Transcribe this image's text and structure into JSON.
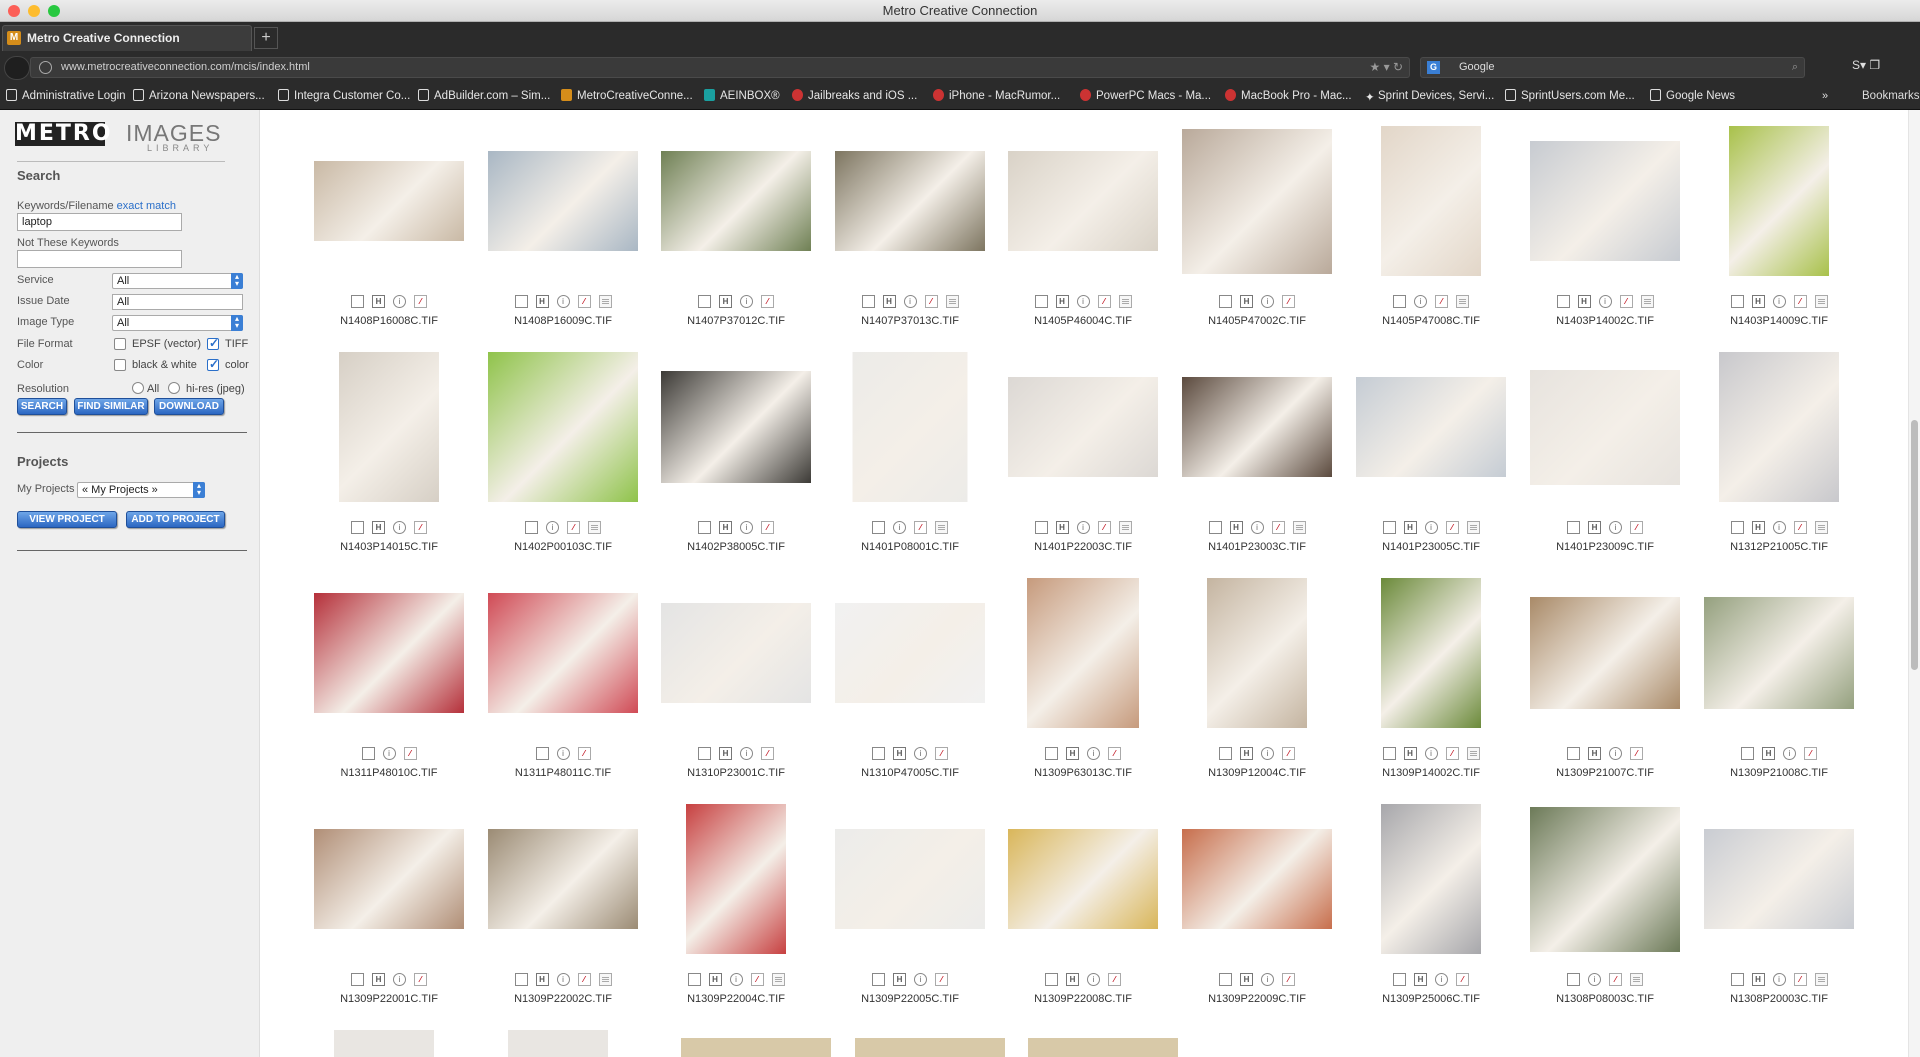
{
  "window": {
    "title": "Metro Creative Connection"
  },
  "tab": {
    "title": "Metro Creative Connection",
    "new_tab": "+"
  },
  "nav": {
    "url": "www.metrocreativeconnection.com/mcis/index.html",
    "search_engine": "Google"
  },
  "bookmarks": {
    "items": [
      "Administrative Login",
      "Arizona Newspapers...",
      "Integra Customer Co...",
      "AdBuilder.com – Sim...",
      "MetroCreativeConne...",
      "AEINBOX®",
      "Jailbreaks and iOS ...",
      "iPhone - MacRumor...",
      "PowerPC Macs - Ma...",
      "MacBook Pro - Mac...",
      "Sprint Devices, Servi...",
      "SprintUsers.com Me...",
      "Google News"
    ],
    "more": "»",
    "right": "Bookmarks"
  },
  "sidebar": {
    "logo_metro": "METRO",
    "logo_images": "IMAGES",
    "logo_library": "LIBRARY",
    "search_heading": "Search",
    "keywords_label": "Keywords/Filename",
    "exact_match": "exact match",
    "keywords_value": "laptop",
    "not_keywords_label": "Not These Keywords",
    "not_keywords_value": "",
    "service_label": "Service",
    "service_value": "All",
    "issue_date_label": "Issue Date",
    "issue_date_value": "All",
    "image_type_label": "Image Type",
    "image_type_value": "All",
    "file_format_label": "File Format",
    "epsf_label": "EPSF (vector)",
    "tiff_label": "TIFF",
    "color_label": "Color",
    "bw_label": "black & white",
    "color_opt_label": "color",
    "resolution_label": "Resolution",
    "res_all": "All",
    "res_hires": "hi-res (jpeg)",
    "btn_search": "SEARCH",
    "btn_find_similar": "FIND SIMILAR",
    "btn_download": "DOWNLOAD",
    "projects_heading": "Projects",
    "my_projects_label": "My Projects",
    "my_projects_value": "« My Projects »",
    "btn_view_project": "VIEW PROJECT",
    "btn_add_to_project": "ADD TO PROJECT"
  },
  "results": [
    {
      "file": "N1408P16008C.TIF",
      "w": 150,
      "h": 80,
      "icons": "shid"
    },
    {
      "file": "N1408P16009C.TIF",
      "w": 150,
      "h": 100,
      "icons": "shidx"
    },
    {
      "file": "N1407P37012C.TIF",
      "w": 150,
      "h": 100,
      "icons": "shid"
    },
    {
      "file": "N1407P37013C.TIF",
      "w": 150,
      "h": 100,
      "icons": "shidx"
    },
    {
      "file": "N1405P46004C.TIF",
      "w": 150,
      "h": 100,
      "icons": "shidx"
    },
    {
      "file": "N1405P47002C.TIF",
      "w": 150,
      "h": 145,
      "icons": "shid"
    },
    {
      "file": "N1405P47008C.TIF",
      "w": 100,
      "h": 150,
      "icons": "sidx"
    },
    {
      "file": "N1403P14002C.TIF",
      "w": 150,
      "h": 120,
      "icons": "shidx"
    },
    {
      "file": "N1403P14009C.TIF",
      "w": 100,
      "h": 150,
      "icons": "shidx"
    },
    {
      "file": "N1403P14015C.TIF",
      "w": 100,
      "h": 150,
      "icons": "shid"
    },
    {
      "file": "N1402P00103C.TIF",
      "w": 150,
      "h": 150,
      "icons": "sidx"
    },
    {
      "file": "N1402P38005C.TIF",
      "w": 150,
      "h": 112,
      "icons": "shid"
    },
    {
      "file": "N1401P08001C.TIF",
      "w": 115,
      "h": 150,
      "icons": "sidx"
    },
    {
      "file": "N1401P22003C.TIF",
      "w": 150,
      "h": 100,
      "icons": "shidx"
    },
    {
      "file": "N1401P23003C.TIF",
      "w": 150,
      "h": 100,
      "icons": "shidx"
    },
    {
      "file": "N1401P23005C.TIF",
      "w": 150,
      "h": 100,
      "icons": "shidx"
    },
    {
      "file": "N1401P23009C.TIF",
      "w": 150,
      "h": 115,
      "icons": "shid"
    },
    {
      "file": "N1312P21005C.TIF",
      "w": 120,
      "h": 150,
      "icons": "shidx"
    },
    {
      "file": "N1311P48010C.TIF",
      "w": 150,
      "h": 120,
      "icons": "sid"
    },
    {
      "file": "N1311P48011C.TIF",
      "w": 150,
      "h": 120,
      "icons": "sid"
    },
    {
      "file": "N1310P23001C.TIF",
      "w": 150,
      "h": 100,
      "icons": "shid"
    },
    {
      "file": "N1310P47005C.TIF",
      "w": 150,
      "h": 100,
      "icons": "shid"
    },
    {
      "file": "N1309P63013C.TIF",
      "w": 112,
      "h": 150,
      "icons": "shid"
    },
    {
      "file": "N1309P12004C.TIF",
      "w": 100,
      "h": 150,
      "icons": "shid"
    },
    {
      "file": "N1309P14002C.TIF",
      "w": 100,
      "h": 150,
      "icons": "shidx"
    },
    {
      "file": "N1309P21007C.TIF",
      "w": 150,
      "h": 112,
      "icons": "shid"
    },
    {
      "file": "N1309P21008C.TIF",
      "w": 150,
      "h": 112,
      "icons": "shid"
    },
    {
      "file": "N1309P22001C.TIF",
      "w": 150,
      "h": 100,
      "icons": "shid"
    },
    {
      "file": "N1309P22002C.TIF",
      "w": 150,
      "h": 100,
      "icons": "shidx"
    },
    {
      "file": "N1309P22004C.TIF",
      "w": 100,
      "h": 150,
      "icons": "shidx"
    },
    {
      "file": "N1309P22005C.TIF",
      "w": 150,
      "h": 100,
      "icons": "shid"
    },
    {
      "file": "N1309P22008C.TIF",
      "w": 150,
      "h": 100,
      "icons": "shid"
    },
    {
      "file": "N1309P22009C.TIF",
      "w": 150,
      "h": 100,
      "icons": "shid"
    },
    {
      "file": "N1309P25006C.TIF",
      "w": 100,
      "h": 150,
      "icons": "shid"
    },
    {
      "file": "N1308P08003C.TIF",
      "w": 150,
      "h": 145,
      "icons": "sidx"
    },
    {
      "file": "N1308P20003C.TIF",
      "w": 150,
      "h": 100,
      "icons": "shidx"
    }
  ],
  "colors": {
    "accent": "#2c67c2",
    "pdf": "#c1121f",
    "sidebar_bg": "#efefef",
    "chrome": "#2b2b2b"
  }
}
